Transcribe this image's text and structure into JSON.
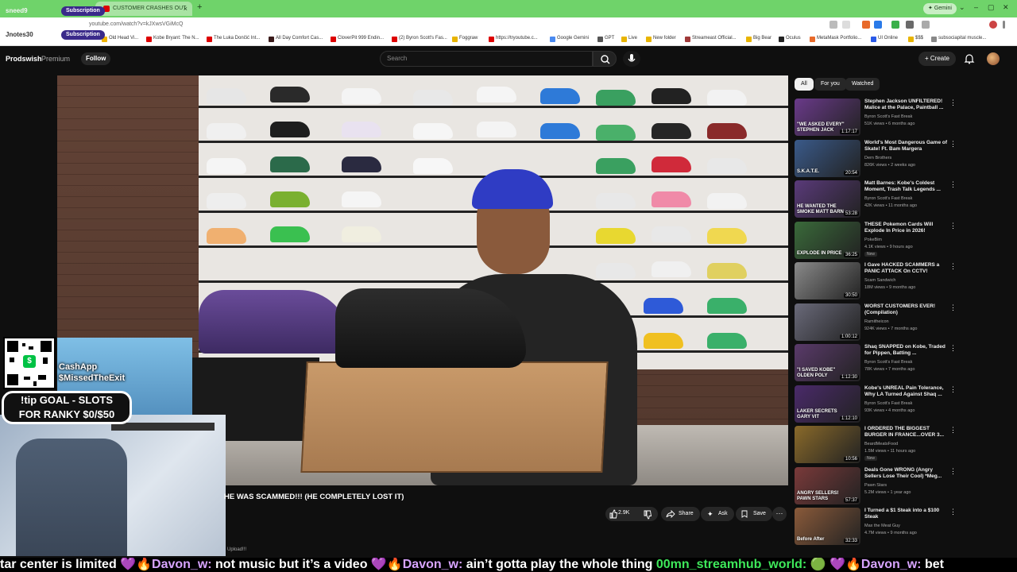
{
  "browser": {
    "active_tab_title": "CUSTOMER CRASHES OUT AFT",
    "url": "youtube.com/watch?v=kJXwsVGiMcQ",
    "gemini_label": "Gemini",
    "bookmarks": [
      "Old Head Vi...",
      "Kobe Bryant: The N...",
      "The Luka Dončić Int...",
      "All Day Comfort Cas...",
      "CloverPit 999 Endin...",
      "(2) Byron Scott's Fas...",
      "Foggraw",
      "https://tryoutube.c...",
      "Google Gemini",
      "GPT",
      "Live",
      "New folder",
      "Streameast Official...",
      "Big Bear",
      "Oculus",
      "MetaMask Portfolio...",
      "UI Online",
      "$$$",
      "subsociapital muscle..."
    ]
  },
  "overlay": {
    "sub1_name": "sneed9",
    "sub1_label": "Subscription",
    "sub2_name": "Jnotes30",
    "sub2_label": "Subscription",
    "cashapp_label": "CashApp",
    "cashapp_handle": "$MissedTheExit",
    "goal_line1": "!tip GOAL - SLOTS",
    "goal_line2": "FOR RANKY $0/$50"
  },
  "header": {
    "channel": "Prodswish",
    "premium": "Premium",
    "follow": "Follow",
    "search_placeholder": "Search",
    "create": "Create"
  },
  "video": {
    "title": "HE WAS SCAMMED!!! (HE COMPLETELY LOST IT)",
    "likes": "2.9K",
    "share": "Share",
    "ask": "Ask",
    "save": "Save",
    "desc_snippet": "Upload!!!"
  },
  "sidebar": {
    "chips": [
      "All",
      "For you",
      "Watched"
    ],
    "items": [
      {
        "title": "Stephen Jackson UNFILTERED! Malice at the Palace, Paintball ...",
        "channel": "Byron Scott's Fast Break",
        "meta": "51K views • 6 months ago",
        "duration": "1:17:17",
        "thumb_text": "\"WE ASKED EVERY\" STEPHEN JACK",
        "color": "#6a3a8a"
      },
      {
        "title": "World's Most Dangerous Game of Skate! Ft. Bam Margera",
        "channel": "Dern Brothers",
        "meta": "826K views • 2 weeks ago",
        "duration": "20:54",
        "thumb_text": "S.K.A.T.E.",
        "color": "#3a5a8a"
      },
      {
        "title": "Matt Barnes: Kobe's Coldest Moment, Trash Talk Legends ...",
        "channel": "Byron Scott's Fast Break",
        "meta": "42K views • 11 months ago",
        "duration": "53:28",
        "thumb_text": "HE WANTED THE SMOKE MATT BARN",
        "color": "#5a3a7a"
      },
      {
        "title": "THESE Pokemon Cards Will Explode In Price in 2026!",
        "channel": "PokeBim",
        "meta": "4.1K views • 9 hours ago",
        "duration": "36:25",
        "thumb_text": "EXPLODE IN PRICE",
        "color": "#3a6a3a",
        "is_new": true,
        "new_label": "New"
      },
      {
        "title": "I Gave HACKED SCAMMERS a PANIC ATTACK On CCTV!",
        "channel": "Scam Sandwich",
        "meta": "18M views • 9 months ago",
        "duration": "30:50",
        "thumb_text": "",
        "color": "#8a8a8a"
      },
      {
        "title": "WORST CUSTOMERS EVER! (Compilation)",
        "channel": "Ramitheicon",
        "meta": "924K views • 7 months ago",
        "duration": "1:00:12",
        "thumb_text": "",
        "color": "#6a6a7a"
      },
      {
        "title": "Shaq SNAPPED on Kobe, Traded for Pippen, Batting ...",
        "channel": "Byron Scott's Fast Break",
        "meta": "78K views • 7 months ago",
        "duration": "1:12:30",
        "thumb_text": "\"I SAVED KOBE\" OLDEN POLY",
        "color": "#5a3a6a"
      },
      {
        "title": "Kobe's UNREAL Pain Tolerance, Why LA Turned Against Shaq ...",
        "channel": "Byron Scott's Fast Break",
        "meta": "93K views • 4 months ago",
        "duration": "1:12:10",
        "thumb_text": "LAKER SECRETS GARY VIT",
        "color": "#4a2a6a"
      },
      {
        "title": "I ORDERED THE BIGGEST BURGER IN FRANCE...OVER 3...",
        "channel": "BeardMeatsFood",
        "meta": "1.5M views • 11 hours ago",
        "duration": "10:56",
        "thumb_text": "",
        "color": "#8a6a2a",
        "is_new": true,
        "new_label": "New"
      },
      {
        "title": "Deals Gone WRONG (Angry Sellers Lose Their Cool) *Meg...",
        "channel": "Pawn Stars",
        "meta": "5.2M views • 1 year ago",
        "duration": "57:37",
        "thumb_text": "ANGRY SELLERS! PAWN STARS",
        "color": "#7a3a3a"
      },
      {
        "title": "I Turned a $1 Steak into a $100 Steak",
        "channel": "Max the Meat Guy",
        "meta": "4.7M views • 9 months ago",
        "duration": "32:33",
        "thumb_text": "Before   After",
        "color": "#8a5a3a"
      }
    ]
  },
  "chat": {
    "segments": [
      {
        "text": "tar center is limited ",
        "color": "#ffffff"
      },
      {
        "text": "💜🔥Davon_w: ",
        "color": "#d8a4ff"
      },
      {
        "text": "not music but it’s a video ",
        "color": "#ffffff"
      },
      {
        "text": "💜🔥Davon_w: ",
        "color": "#d8a4ff"
      },
      {
        "text": "ain’t gotta play the whole thing ",
        "color": "#ffffff"
      },
      {
        "text": "00mn_streamhub_world: ",
        "color": "#3ee85a"
      },
      {
        "text": "🟢 ",
        "color": "#ffffff"
      },
      {
        "text": "💜🔥Davon_w: ",
        "color": "#d8a4ff"
      },
      {
        "text": "bet",
        "color": "#ffffff"
      }
    ]
  }
}
